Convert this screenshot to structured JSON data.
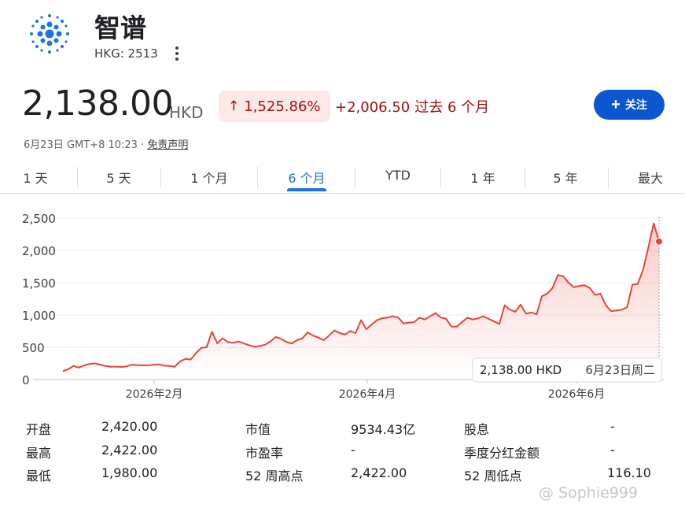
{
  "header": {
    "company_name": "智谱",
    "ticker": "HKG: 2513",
    "menu_icon": "more-vert-icon",
    "logo_color": "#1a73e8"
  },
  "quote": {
    "price": "2,138.00",
    "currency": "HKD",
    "percent_change": "1,525.86%",
    "percent_arrow": "↑",
    "abs_change": "+2,006.50",
    "period_label": "过去 6 个月",
    "timestamp": "6月23日 GMT+8 10:23 · ",
    "disclaimer": "免责声明",
    "follow_label": "关注",
    "down_color": "#a50e0e"
  },
  "tabs": [
    "1 天",
    "5 天",
    "1 个月",
    "6 个月",
    "YTD",
    "1 年",
    "5 年",
    "最大"
  ],
  "active_tab": 3,
  "chart_data": {
    "type": "area",
    "y_ticks": [
      "2,500",
      "2,000",
      "1,500",
      "1,000",
      "500",
      "0"
    ],
    "x_ticks": [
      "2026年2月",
      "2026年4月",
      "2026年6月"
    ],
    "ylim": [
      0,
      2500
    ],
    "grid": true,
    "line_color": "#ea4335",
    "values": [
      130,
      160,
      210,
      185,
      220,
      240,
      250,
      230,
      210,
      200,
      200,
      195,
      205,
      230,
      225,
      220,
      220,
      230,
      235,
      215,
      210,
      200,
      280,
      320,
      310,
      410,
      490,
      500,
      740,
      560,
      640,
      580,
      570,
      590,
      560,
      530,
      510,
      520,
      540,
      590,
      660,
      630,
      580,
      560,
      610,
      640,
      730,
      680,
      650,
      610,
      680,
      760,
      720,
      700,
      750,
      720,
      920,
      780,
      850,
      920,
      950,
      960,
      980,
      960,
      870,
      880,
      890,
      960,
      930,
      980,
      1030,
      960,
      940,
      820,
      820,
      890,
      960,
      930,
      950,
      980,
      940,
      900,
      860,
      1150,
      1080,
      1050,
      1160,
      1020,
      1040,
      1010,
      1290,
      1330,
      1420,
      1620,
      1600,
      1500,
      1430,
      1450,
      1460,
      1420,
      1310,
      1330,
      1150,
      1060,
      1070,
      1080,
      1120,
      1470,
      1480,
      1700,
      2050,
      2420,
      2138
    ],
    "tooltip": {
      "price": "2,138.00 HKD",
      "date": "6月23日周二"
    }
  },
  "stats": {
    "labels": [
      "开盘",
      "最高",
      "最低",
      "市值",
      "市盈率",
      "52 周高点",
      "股息",
      "季度分红金额",
      "52 周低点"
    ],
    "values": [
      "2,420.00",
      "2,422.00",
      "1,980.00",
      "9534.43亿",
      "-",
      "2,422.00",
      "-",
      "-",
      "116.10"
    ]
  },
  "watermark": "@ Sophie999"
}
